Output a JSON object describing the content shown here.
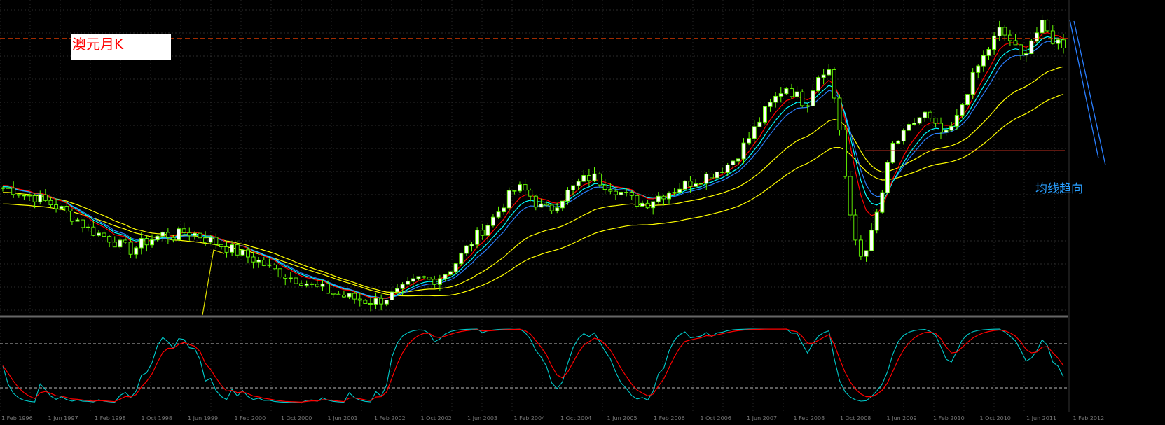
{
  "title": "澳元月K",
  "annotation": "均线趋向",
  "chart_data": {
    "type": "candlestick",
    "instrument_label": "澳元月K",
    "price_axis_labels": false,
    "time_axis": [
      "1 Feb 1996",
      "1 Jun 1997",
      "1 Feb 1998",
      "1 Oct 1998",
      "1 Jun 1999",
      "1 Feb 2000",
      "1 Oct 2000",
      "1 Jun 2001",
      "1 Feb 2002",
      "1 Oct 2002",
      "1 Jun 2003",
      "1 Feb 2004",
      "1 Oct 2004",
      "1 Jun 2005",
      "1 Feb 2006",
      "1 Oct 2006",
      "1 Jun 2007",
      "1 Feb 2008",
      "1 Oct 2008",
      "1 Jun 2009",
      "1 Feb 2010",
      "1 Oct 2010",
      "1 Jun 2011",
      "1 Feb 2012"
    ],
    "close_series_normalized": [
      0.8,
      0.79,
      0.77,
      0.76,
      0.74,
      0.72,
      0.69,
      0.66,
      0.62,
      0.6,
      0.58,
      0.55,
      0.53,
      0.56,
      0.58,
      0.6,
      0.59,
      0.61,
      0.6,
      0.58,
      0.56,
      0.54,
      0.52,
      0.5,
      0.48,
      0.45,
      0.43,
      0.41,
      0.4,
      0.37,
      0.36,
      0.34,
      0.33,
      0.32,
      0.31,
      0.31,
      0.33,
      0.35,
      0.38,
      0.41,
      0.4,
      0.42,
      0.46,
      0.52,
      0.58,
      0.63,
      0.68,
      0.75,
      0.8,
      0.78,
      0.72,
      0.7,
      0.75,
      0.79,
      0.83,
      0.85,
      0.82,
      0.8,
      0.77,
      0.74,
      0.73,
      0.76,
      0.78,
      0.8,
      0.82,
      0.84,
      0.86,
      0.88,
      0.91,
      0.97,
      1.04,
      1.12,
      1.18,
      1.24,
      1.2,
      1.16,
      1.28,
      1.33,
      1.1,
      0.68,
      0.5,
      0.58,
      0.76,
      0.98,
      1.02,
      1.08,
      1.12,
      1.06,
      1.02,
      1.09,
      1.22,
      1.32,
      1.4,
      1.48,
      1.44,
      1.36,
      1.44,
      1.5,
      1.44,
      1.42
    ],
    "moving_averages": [
      {
        "color": "#ffff00",
        "role": "slow"
      },
      {
        "color": "#ffff00",
        "role": "medium"
      },
      {
        "color": "#2a7fff",
        "role": "fast"
      },
      {
        "color": "#00ffff",
        "role": "fast"
      },
      {
        "color": "#ff0000",
        "role": "fast"
      }
    ],
    "oscillator": {
      "type": "stochastic",
      "levels": [
        80,
        20
      ],
      "k_color": "#00cccc",
      "d_color": "#ff0000"
    },
    "grid": true,
    "colors": {
      "background": "#000000",
      "bull_candle": "#ffffff",
      "bear_candle": "#66ff00",
      "wick": "#66ff00",
      "grid": "#3a3a3a",
      "price_line": "#ff4400",
      "annotation": "#2a9fff",
      "title_text": "#ff0000",
      "title_bg": "#ffffff"
    }
  }
}
